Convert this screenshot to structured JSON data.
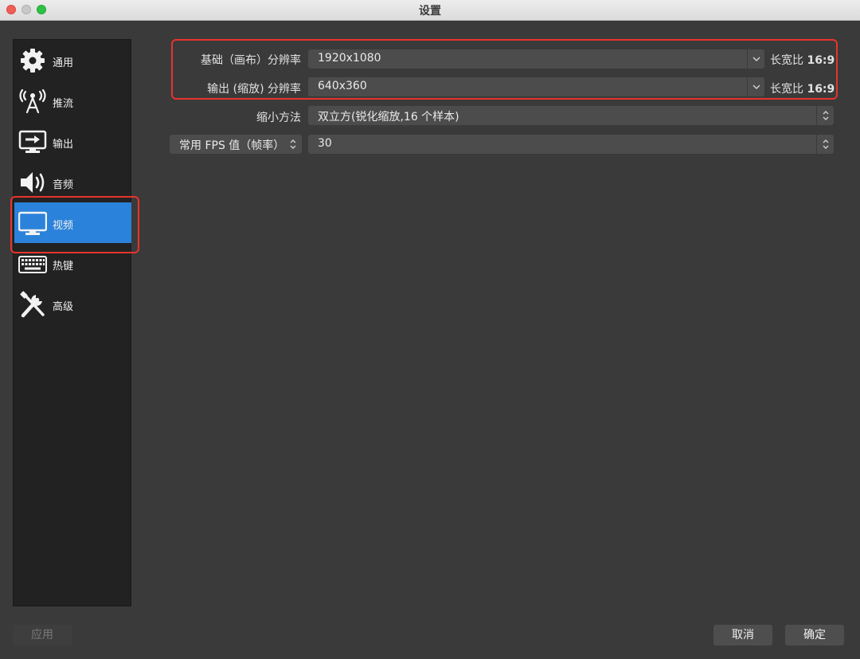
{
  "window": {
    "title": "设置"
  },
  "sidebar": {
    "items": [
      {
        "label": "通用",
        "icon": "gear-icon"
      },
      {
        "label": "推流",
        "icon": "broadcast-antenna-icon"
      },
      {
        "label": "输出",
        "icon": "output-monitor-icon"
      },
      {
        "label": "音频",
        "icon": "speaker-icon"
      },
      {
        "label": "视频",
        "icon": "monitor-icon",
        "active": true
      },
      {
        "label": "热键",
        "icon": "keyboard-icon"
      },
      {
        "label": "高级",
        "icon": "tools-icon"
      }
    ]
  },
  "video": {
    "base_resolution": {
      "label": "基础（画布）分辨率",
      "value": "1920x1080",
      "aspect_prefix": "长宽比",
      "aspect": "16:9"
    },
    "output_resolution": {
      "label": "输出 (缩放) 分辨率",
      "value": "640x360",
      "aspect_prefix": "长宽比",
      "aspect": "16:9"
    },
    "downscale_filter": {
      "label": "缩小方法",
      "value": "双立方(锐化缩放,16 个样本)"
    },
    "fps": {
      "type_label": "常用 FPS 值（帧率）",
      "value": "30"
    }
  },
  "buttons": {
    "apply": "应用",
    "cancel": "取消",
    "ok": "确定"
  },
  "colors": {
    "accent": "#2a82da",
    "highlight": "#e8332d",
    "background": "#3a3a3a",
    "sidebar": "#222222"
  }
}
